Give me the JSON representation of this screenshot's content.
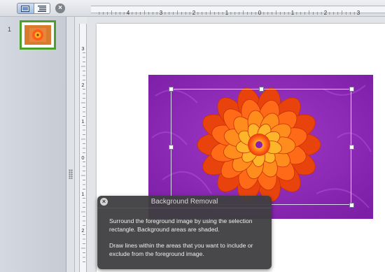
{
  "toolbar": {
    "view_buttons": [
      {
        "name": "normal-view",
        "icon": "slide-view-icon",
        "active": true
      },
      {
        "name": "outline-view",
        "icon": "outline-view-icon",
        "active": false
      }
    ],
    "close_icon": "close-pane-icon"
  },
  "slide_pane": {
    "slides": [
      {
        "number": "1",
        "selected": true,
        "thumbnail": "marigold-thumbnail"
      }
    ],
    "selection_color": "#4d9f2b"
  },
  "rulers": {
    "horizontal_labels": [
      "4",
      "3",
      "2",
      "1",
      "0",
      "1",
      "2",
      "3"
    ],
    "vertical_labels": [
      "3",
      "2",
      "1",
      "0",
      "1",
      "2"
    ]
  },
  "slide": {
    "image": "marigold-flower-photo",
    "removal_overlay_color": "#8a1fb0"
  },
  "background_removal_panel": {
    "title": "Background Removal",
    "close_icon": "close-icon",
    "paragraph1": "Surround the foreground image by using the selection rectangle. Background areas are shaded.",
    "paragraph2": "Draw lines within the areas that you want to include or exclude from the foreground image."
  }
}
